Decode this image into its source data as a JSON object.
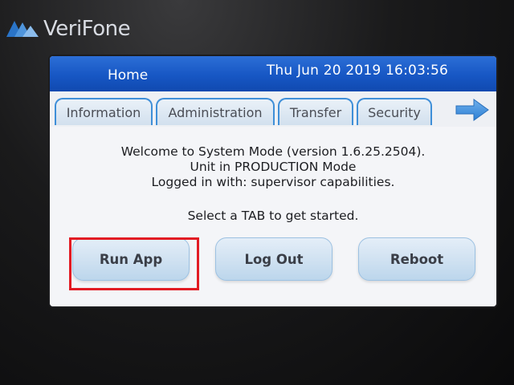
{
  "device": {
    "brand": "VeriFone",
    "logo_icon": "verifone-logo-icon"
  },
  "header": {
    "title": "Home",
    "datetime": "Thu Jun 20 2019 16:03:56"
  },
  "tabs": [
    {
      "label": "Information"
    },
    {
      "label": "Administration"
    },
    {
      "label": "Transfer"
    },
    {
      "label": "Security"
    }
  ],
  "next_tabs_icon": "arrow-right-icon",
  "content": {
    "welcome_lines": [
      "Welcome to System Mode (version 1.6.25.2504).",
      "Unit in PRODUCTION Mode",
      "Logged in with: supervisor capabilities."
    ],
    "prompt": "Select a TAB to get started."
  },
  "buttons": {
    "run_app": "Run App",
    "log_out": "Log Out",
    "reboot": "Reboot"
  },
  "colors": {
    "header_blue": "#1757c4",
    "tab_border": "#3f8fd8",
    "button_fill": "#cfe1f1",
    "highlight_red": "#e21b23"
  }
}
